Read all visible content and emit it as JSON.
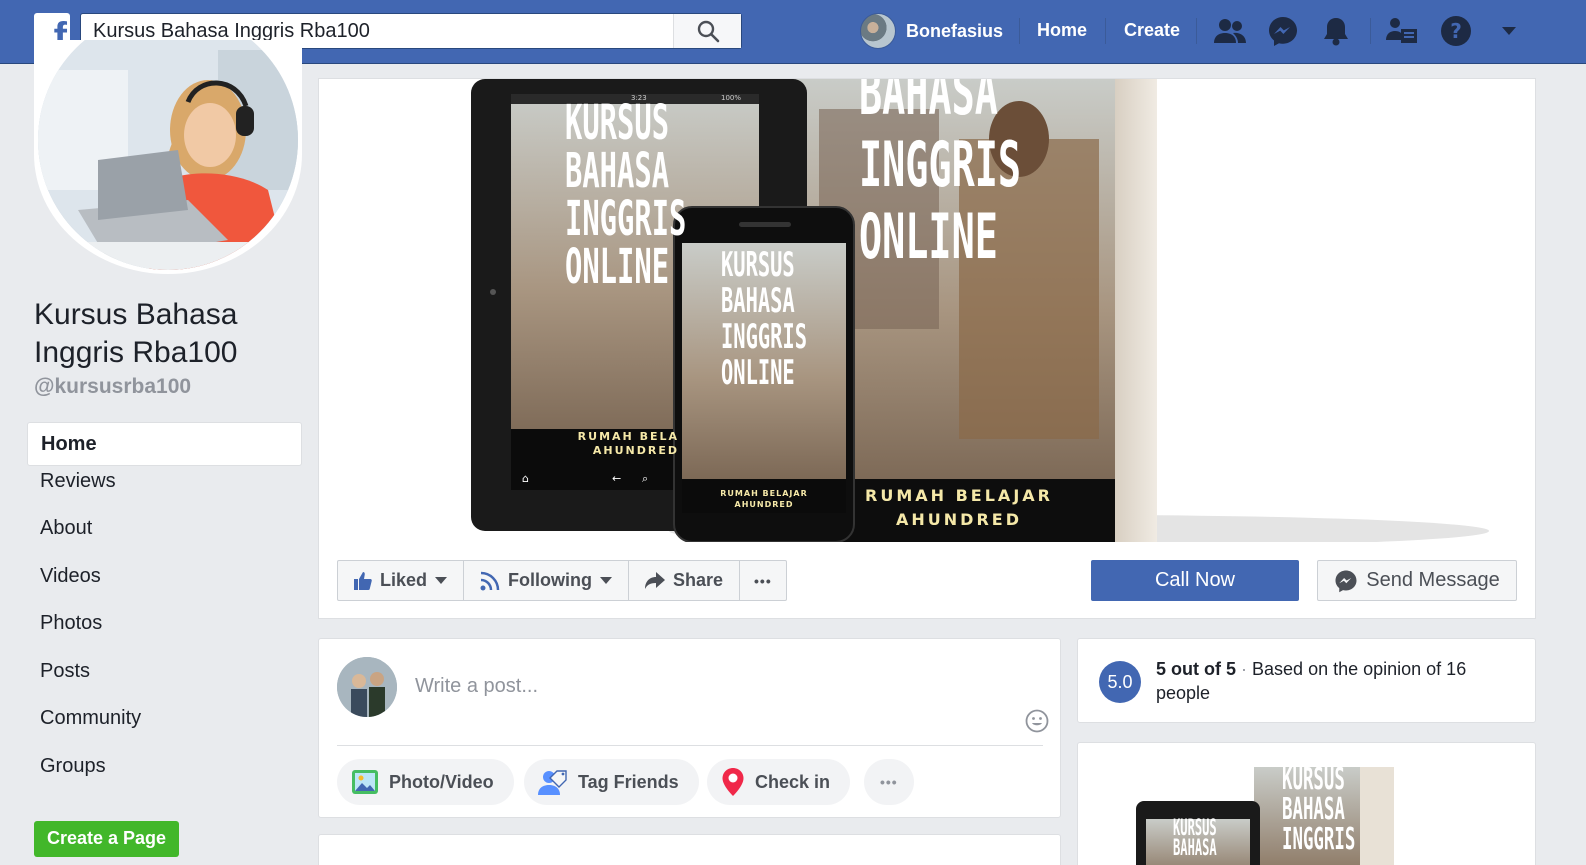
{
  "topbar": {
    "search_value": "Kursus Bahasa Inggris Rba100",
    "user_name": "Bonefasius",
    "home": "Home",
    "create": "Create",
    "logo_letter": "f"
  },
  "page": {
    "name": "Kursus Bahasa Inggris Rba100",
    "handle": "@kursusrba100"
  },
  "sidebar": {
    "items": [
      {
        "label": "Home"
      },
      {
        "label": "Reviews"
      },
      {
        "label": "About"
      },
      {
        "label": "Videos"
      },
      {
        "label": "Photos"
      },
      {
        "label": "Posts"
      },
      {
        "label": "Community"
      },
      {
        "label": "Groups"
      }
    ],
    "create_page": "Create a Page"
  },
  "cover": {
    "tablet_lines": [
      "KURSUS",
      "BAHASA",
      "INGGRIS",
      "ONLINE"
    ],
    "book_lines": [
      "BAHASA",
      "INGGRIS",
      "ONLINE"
    ],
    "phone_lines": [
      "KURSUS",
      "BAHASA",
      "INGGRIS",
      "ONLINE"
    ],
    "publisher_1": "RUMAH BELAJAR",
    "publisher_2": "AHUNDRED",
    "tablet_pub_1": "RUMAH BELA",
    "tablet_pub_2": "AHUNDRED",
    "tablet_status": "3:23",
    "tablet_battery": "100%"
  },
  "actions": {
    "liked": "Liked",
    "following": "Following",
    "share": "Share",
    "more": "•••",
    "call_now": "Call Now",
    "send_message": "Send Message"
  },
  "composer": {
    "placeholder": "Write a post...",
    "photo_video": "Photo/Video",
    "tag_friends": "Tag Friends",
    "check_in": "Check in",
    "more": "•••"
  },
  "rating": {
    "score": "5.0",
    "summary": "5 out of 5",
    "separator": "·",
    "detail": "Based on the opinion of 16 people"
  },
  "promo": {
    "book_lines": [
      "KURSUS",
      "BAHASA",
      "INGGRIS"
    ],
    "tablet_lines": [
      "KURSUS",
      "BAHASA"
    ]
  },
  "colors": {
    "brand": "#4267b2",
    "create_page": "#42b72a",
    "background": "#e9ebee"
  }
}
